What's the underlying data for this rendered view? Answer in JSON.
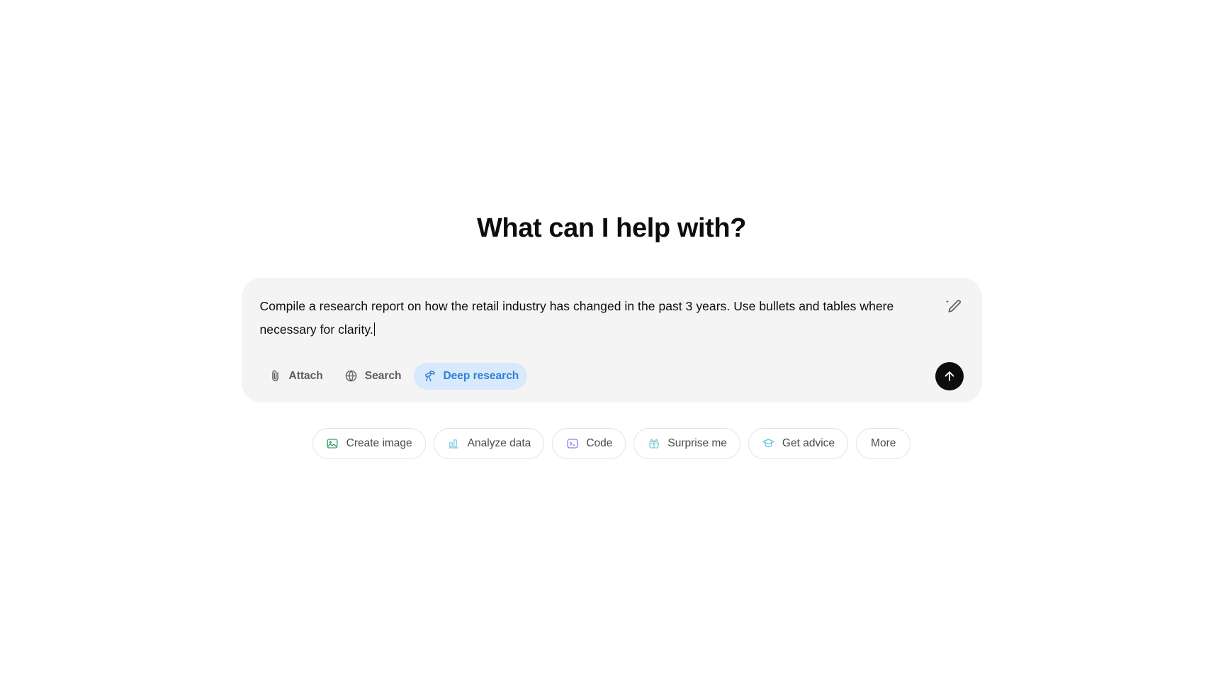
{
  "page": {
    "greeting": "What can I help with?"
  },
  "composer": {
    "text": "Compile a research report on how the retail industry has changed in the past 3 years. Use bullets and tables where necessary for clarity.",
    "caret_visible": true,
    "magic_edit_icon": "pencil-sparkle-icon",
    "send_icon": "arrow-up-icon",
    "send_bg": "#0d0d0d",
    "background": "#f4f4f4",
    "tools": [
      {
        "label": "Attach",
        "icon": "paperclip-icon",
        "active": false
      },
      {
        "label": "Search",
        "icon": "globe-icon",
        "active": false
      },
      {
        "label": "Deep research",
        "icon": "telescope-icon",
        "active": true,
        "active_bg": "#d7e9fb",
        "active_color": "#2f7fd4"
      }
    ]
  },
  "suggestions": [
    {
      "label": "Create image",
      "icon": "image-icon",
      "color": "#3aa06b"
    },
    {
      "label": "Analyze data",
      "icon": "bar-chart-icon",
      "color": "#8fcfe0"
    },
    {
      "label": "Code",
      "icon": "terminal-icon",
      "color": "#8a7ee8"
    },
    {
      "label": "Surprise me",
      "icon": "gift-icon",
      "color": "#84ccd4"
    },
    {
      "label": "Get advice",
      "icon": "graduation-cap-icon",
      "color": "#6ec6dc"
    },
    {
      "label": "More",
      "icon": null,
      "color": null
    }
  ]
}
